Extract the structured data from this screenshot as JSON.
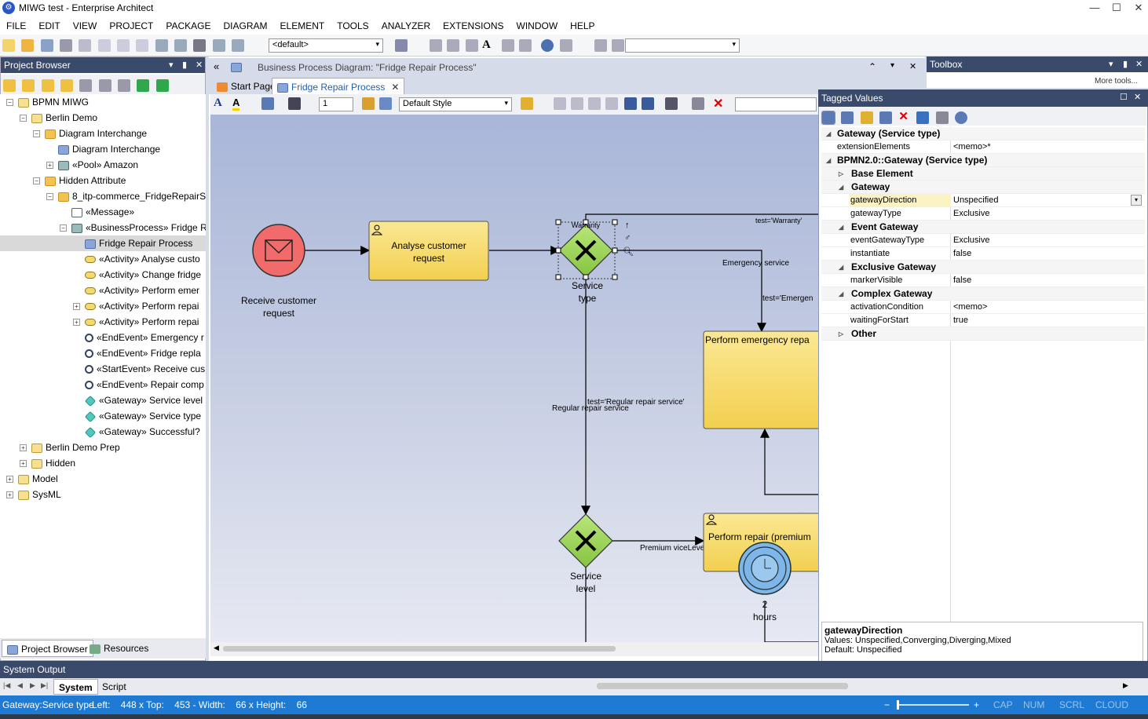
{
  "window": {
    "title": "MIWG test - Enterprise Architect",
    "minimize": "—",
    "maximize": "☐",
    "close": "✕"
  },
  "menu": [
    "FILE",
    "EDIT",
    "VIEW",
    "PROJECT",
    "PACKAGE",
    "DIAGRAM",
    "ELEMENT",
    "TOOLS",
    "ANALYZER",
    "EXTENSIONS",
    "WINDOW",
    "HELP"
  ],
  "toolbar": {
    "perspective_value": "<default>",
    "search_value": ""
  },
  "project_browser": {
    "title": "Project Browser",
    "items": [
      {
        "label": "BPMN MIWG",
        "indent": 0,
        "expander": "−",
        "icon": "pkg"
      },
      {
        "label": "Berlin Demo",
        "indent": 1,
        "expander": "−",
        "icon": "pkg"
      },
      {
        "label": "Diagram Interchange",
        "indent": 2,
        "expander": "−",
        "icon": "folder"
      },
      {
        "label": "Diagram Interchange",
        "indent": 3,
        "expander": "",
        "icon": "dgm"
      },
      {
        "label": "«Pool» Amazon",
        "indent": 3,
        "expander": "+",
        "icon": "bp"
      },
      {
        "label": "Hidden Attribute",
        "indent": 2,
        "expander": "−",
        "icon": "folder"
      },
      {
        "label": "8_itp-commerce_FridgeRepairS",
        "indent": 3,
        "expander": "−",
        "icon": "folder"
      },
      {
        "label": "«Message»",
        "indent": 4,
        "expander": "",
        "icon": "msg"
      },
      {
        "label": "«BusinessProcess» Fridge Re",
        "indent": 4,
        "expander": "−",
        "icon": "bp"
      },
      {
        "label": "Fridge Repair Process",
        "indent": 5,
        "expander": "",
        "icon": "dgm",
        "selected": true
      },
      {
        "label": "«Activity» Analyse custo",
        "indent": 5,
        "expander": "",
        "icon": "act"
      },
      {
        "label": "«Activity» Change fridge",
        "indent": 5,
        "expander": "",
        "icon": "act"
      },
      {
        "label": "«Activity» Perform emer",
        "indent": 5,
        "expander": "",
        "icon": "act"
      },
      {
        "label": "«Activity» Perform repai",
        "indent": 5,
        "expander": "+",
        "icon": "act"
      },
      {
        "label": "«Activity» Perform repai",
        "indent": 5,
        "expander": "+",
        "icon": "act"
      },
      {
        "label": "«EndEvent» Emergency r",
        "indent": 5,
        "expander": "",
        "icon": "evt"
      },
      {
        "label": "«EndEvent» Fridge repla",
        "indent": 5,
        "expander": "",
        "icon": "evt"
      },
      {
        "label": "«StartEvent» Receive cus",
        "indent": 5,
        "expander": "",
        "icon": "evt"
      },
      {
        "label": "«EndEvent» Repair comp",
        "indent": 5,
        "expander": "",
        "icon": "evt"
      },
      {
        "label": "«Gateway» Service level",
        "indent": 5,
        "expander": "",
        "icon": "gw"
      },
      {
        "label": "«Gateway» Service type",
        "indent": 5,
        "expander": "",
        "icon": "gw"
      },
      {
        "label": "«Gateway» Successful?",
        "indent": 5,
        "expander": "",
        "icon": "gw"
      },
      {
        "label": "Berlin Demo Prep",
        "indent": 1,
        "expander": "+",
        "icon": "pkg"
      },
      {
        "label": "Hidden",
        "indent": 1,
        "expander": "+",
        "icon": "pkg"
      },
      {
        "label": "Model",
        "indent": 0,
        "expander": "+",
        "icon": "pkg"
      },
      {
        "label": "SysML",
        "indent": 0,
        "expander": "+",
        "icon": "pkg"
      }
    ],
    "tabs": [
      "Project Browser",
      "Resources"
    ]
  },
  "diagram": {
    "caption": "Business Process Diagram: \"Fridge Repair Process\"",
    "tabs": [
      "Start Page",
      "Fridge Repair Process"
    ],
    "line_width_value": "1",
    "style_value": "Default Style",
    "labels": {
      "start_event": "Receive customer request",
      "task_analyse": "Analyse customer request",
      "gw_type_top": "Warranty",
      "gw_type": "Service type",
      "gw_level": "Service level",
      "task_emergency": "Perform emergency repa",
      "task_premium": "Perform repair (premium",
      "timer": "2 hours",
      "edge_warranty": "test='Warranty'",
      "edge_emergency": "Emergency service",
      "edge_emergency_test": "test='Emergen",
      "edge_regular_test": "test='Regular repair service'",
      "edge_regular": "Regular repair service",
      "edge_premium": "Premium viceLevel=='Premium'"
    }
  },
  "toolbox": {
    "title": "Toolbox",
    "more": "More tools..."
  },
  "tagged_values": {
    "title": "Tagged Values",
    "rows": [
      {
        "type": "cat",
        "label": "Gateway (Service type)",
        "level": 0
      },
      {
        "type": "kv",
        "key": "extensionElements",
        "value": "<memo>*",
        "level": 0
      },
      {
        "type": "cat",
        "label": "BPMN2.0::Gateway (Service type)",
        "level": 0
      },
      {
        "type": "cat",
        "label": "Base Element",
        "level": 1,
        "collapsed": true
      },
      {
        "type": "cat",
        "label": "Gateway",
        "level": 1
      },
      {
        "type": "kv",
        "key": "gatewayDirection",
        "value": "Unspecified",
        "level": 1,
        "selected": true
      },
      {
        "type": "kv",
        "key": "gatewayType",
        "value": "Exclusive",
        "level": 1
      },
      {
        "type": "cat",
        "label": "Event Gateway",
        "level": 1
      },
      {
        "type": "kv",
        "key": "eventGatewayType",
        "value": "Exclusive",
        "level": 1
      },
      {
        "type": "kv",
        "key": "instantiate",
        "value": "false",
        "level": 1
      },
      {
        "type": "cat",
        "label": "Exclusive Gateway",
        "level": 1
      },
      {
        "type": "kv",
        "key": "markerVisible",
        "value": "false",
        "level": 1
      },
      {
        "type": "cat",
        "label": "Complex Gateway",
        "level": 1
      },
      {
        "type": "kv",
        "key": "activationCondition",
        "value": "<memo>",
        "level": 1
      },
      {
        "type": "kv",
        "key": "waitingForStart",
        "value": "true",
        "level": 1
      },
      {
        "type": "cat",
        "label": "Other",
        "level": 1,
        "collapsed": true
      }
    ],
    "desc_title": "gatewayDirection",
    "desc_values": "Values: Unspecified,Converging,Diverging,Mixed",
    "desc_default": "Default: Unspecified"
  },
  "system_output": {
    "title": "System Output",
    "tabs": [
      "System",
      "Script"
    ]
  },
  "status": {
    "element": "Gateway:Service type",
    "geometry": "Left:    448 x Top:    453 - Width:    66 x Height:    66",
    "indicators": [
      "CAP",
      "NUM",
      "SCRL",
      "CLOUD"
    ]
  },
  "colors": {
    "accent": "#1e7ad2",
    "pane_header": "#3a4a6b",
    "task_fill": "#f7dc6f",
    "gateway_fill": "#9ed65a",
    "start_event": "#f26b6b",
    "timer": "#7fb6ea"
  }
}
